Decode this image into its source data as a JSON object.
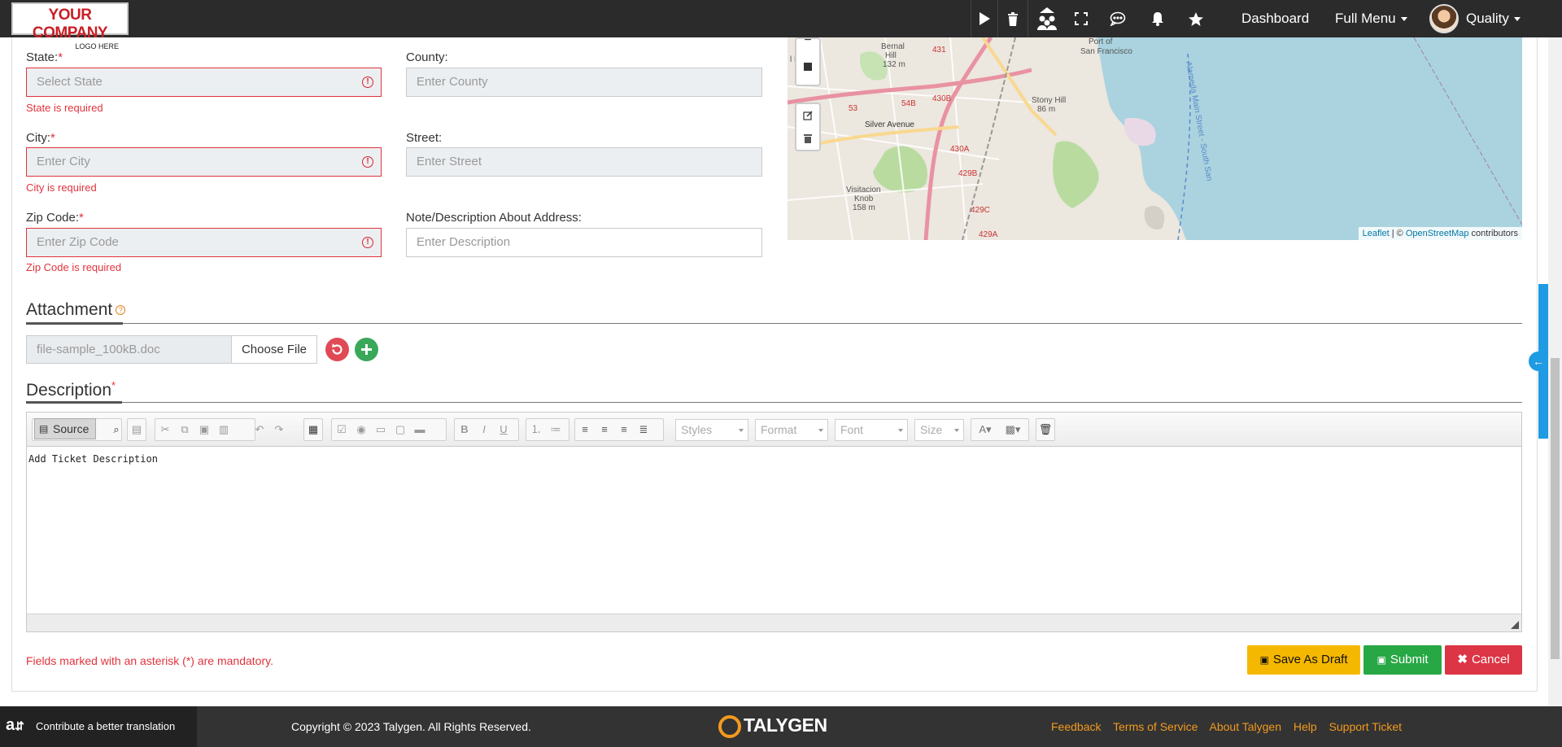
{
  "header": {
    "logo_line1": "YOUR COMPANY",
    "logo_line2": "LOGO HERE",
    "dashboard": "Dashboard",
    "full_menu": "Full Menu",
    "user": "Quality",
    "icons": [
      "play-icon",
      "trash-icon",
      "team-icon",
      "fullscreen-icon",
      "chat-icon",
      "bell-icon",
      "star-icon"
    ]
  },
  "form": {
    "state_label": "State:",
    "state_placeholder": "Select State",
    "state_error": "State is required",
    "county_label": "County:",
    "county_placeholder": "Enter County",
    "city_label": "City:",
    "city_placeholder": "Enter City",
    "city_error": "City is required",
    "street_label": "Street:",
    "street_placeholder": "Enter Street",
    "zip_label": "Zip Code:",
    "zip_placeholder": "Enter Zip Code",
    "zip_error": "Zip Code is required",
    "note_label": "Note/Description About Address:",
    "note_placeholder": "Enter Description",
    "required_mark": "*"
  },
  "map": {
    "attr_leaflet": "Leaflet",
    "attr_sep": " | © ",
    "attr_osm": "OpenStreetMap",
    "attr_tail": " contributors",
    "labels": [
      "Bernal Hill 132 m",
      "Port of San Francisco",
      "Stony Hill 86 m",
      "Silver Avenue",
      "Visitacion Knob 158 m",
      "Alameda Main Street - South San",
      "431",
      "430B",
      "430A",
      "429B",
      "429C",
      "429A",
      "54B",
      "53"
    ]
  },
  "attachment": {
    "title": "Attachment",
    "file_name": "file-sample_100kB.doc",
    "choose_label": "Choose File"
  },
  "description": {
    "title": "Description",
    "source_label": "Source",
    "styles": "Styles",
    "format": "Format",
    "font": "Font",
    "size": "Size",
    "body_text": "Add Ticket Description"
  },
  "actions": {
    "mandatory_note": "Fields marked with an asterisk (*) are mandatory.",
    "save_draft": "Save As Draft",
    "submit": "Submit",
    "cancel": "Cancel",
    "colors": {
      "draft": "#f5b800",
      "submit": "#28a745",
      "cancel": "#dc3545"
    }
  },
  "footer": {
    "contribute": "Contribute a better translation",
    "copyright": "Copyright © 2023 Talygen. All Rights Reserved.",
    "brand": "TALYGEN",
    "links": [
      "Feedback",
      "Terms of Service",
      "About Talygen",
      "Help",
      "Support Ticket"
    ]
  }
}
